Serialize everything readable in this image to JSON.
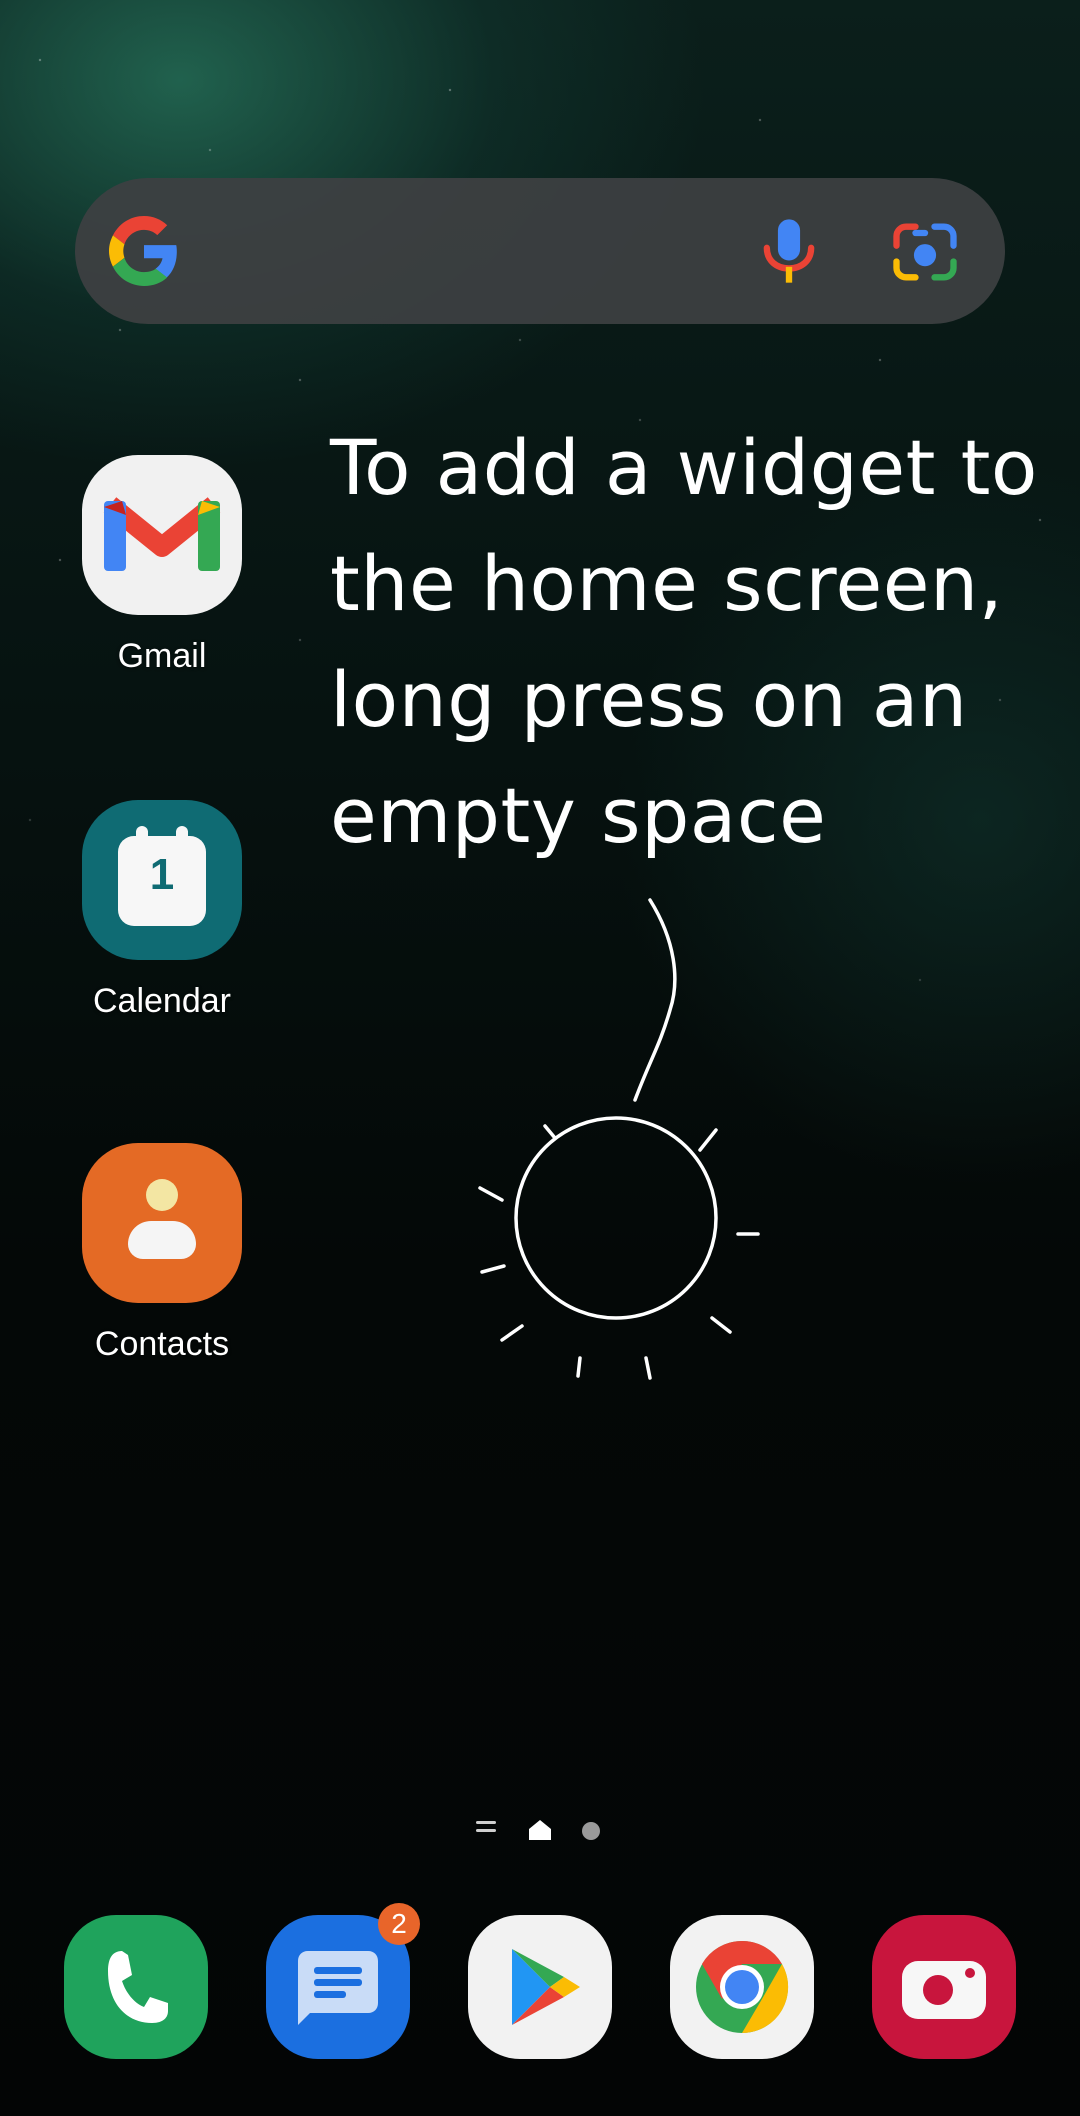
{
  "search": {
    "placeholder": "",
    "icons": [
      "google-g-icon",
      "microphone-icon",
      "google-lens-icon"
    ]
  },
  "apps": [
    {
      "label": "Gmail",
      "icon": "gmail-icon"
    },
    {
      "label": "Calendar",
      "icon": "calendar-icon",
      "day": "1"
    },
    {
      "label": "Contacts",
      "icon": "contacts-icon"
    }
  ],
  "annotation": {
    "text": "To add a widget to the home screen, long press on an empty space"
  },
  "page_indicator": {
    "pages": 2,
    "current": 1
  },
  "dock": [
    {
      "name": "Phone",
      "icon": "phone-icon",
      "color": "#1fa35c"
    },
    {
      "name": "Messages",
      "icon": "messages-icon",
      "color": "#1b6fe0",
      "badge": "2"
    },
    {
      "name": "Play Store",
      "icon": "play-store-icon",
      "color": "#f2f2f2"
    },
    {
      "name": "Chrome",
      "icon": "chrome-icon",
      "color": "#f2f2f2"
    },
    {
      "name": "Camera",
      "icon": "camera-icon",
      "color": "#c8153d"
    }
  ],
  "colors": {
    "badge": "#e8652a",
    "search_bar": "#3e4042"
  }
}
